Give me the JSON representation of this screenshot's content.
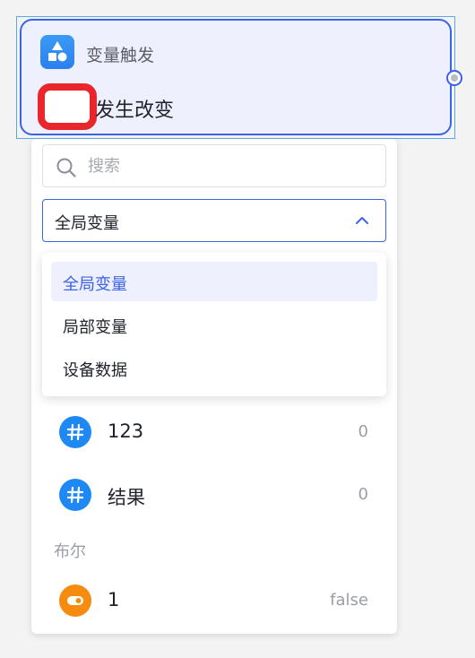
{
  "node": {
    "title": "变量触发",
    "event": "发生改变",
    "icon": "shapes-icon"
  },
  "panel": {
    "search": {
      "placeholder": "搜索",
      "value": ""
    },
    "scope_select": {
      "value": "全局变量",
      "icon": "chevron-up-icon"
    },
    "options": [
      {
        "label": "全局变量",
        "selected": true
      },
      {
        "label": "局部变量",
        "selected": false
      },
      {
        "label": "设备数据",
        "selected": false
      }
    ],
    "variables": [
      {
        "name": "123",
        "value": "0",
        "icon": "hash-icon",
        "color": "#1e88f5"
      },
      {
        "name": "结果",
        "value": "0",
        "icon": "hash-icon",
        "color": "#1e88f5"
      }
    ],
    "group_label": "布尔",
    "bool_variables": [
      {
        "name": "1",
        "value": "false",
        "icon": "toggle-icon",
        "color": "#f58b0f"
      }
    ]
  },
  "colors": {
    "accent": "#3c63e6",
    "highlight": "#e8262c",
    "node_bg": "#eef0fd"
  }
}
